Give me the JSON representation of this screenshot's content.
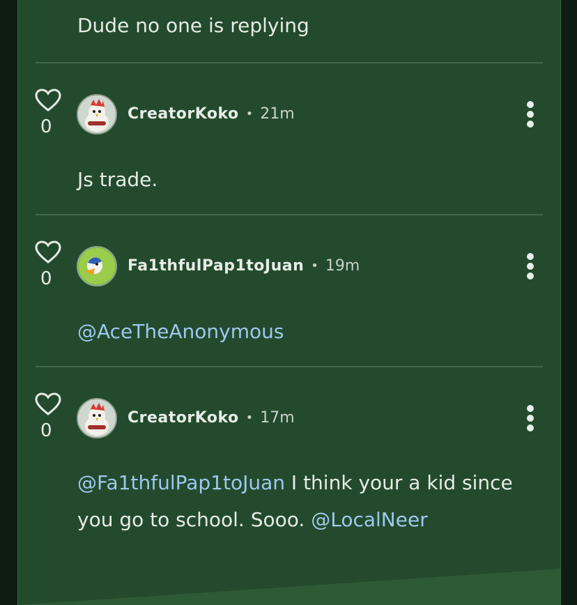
{
  "top_comment": {
    "text": "Dude no one is replying"
  },
  "comments": [
    {
      "likes": "0",
      "username": "CreatorKoko",
      "separator": "•",
      "time": "21m",
      "text_plain": "Js trade.",
      "avatar": "chicken-avatar"
    },
    {
      "likes": "0",
      "username": "Fa1thfulPap1toJuan",
      "separator": "•",
      "time": "19m",
      "mention1": "@AceTheAnonymous",
      "avatar": "duck-avatar"
    },
    {
      "likes": "0",
      "username": "CreatorKoko",
      "separator": "•",
      "time": "17m",
      "mention1": "@Fa1thfulPap1toJuan",
      "text_plain": " I think your a kid since you go to school. Sooo. ",
      "mention2": "@LocalNeer",
      "avatar": "chicken-avatar"
    }
  ],
  "colors": {
    "background": "#234a2c",
    "mention": "#9ec8ee",
    "text": "#e6ece6"
  },
  "icons": {
    "like": "heart-outline-icon",
    "more": "kebab-menu-icon"
  }
}
